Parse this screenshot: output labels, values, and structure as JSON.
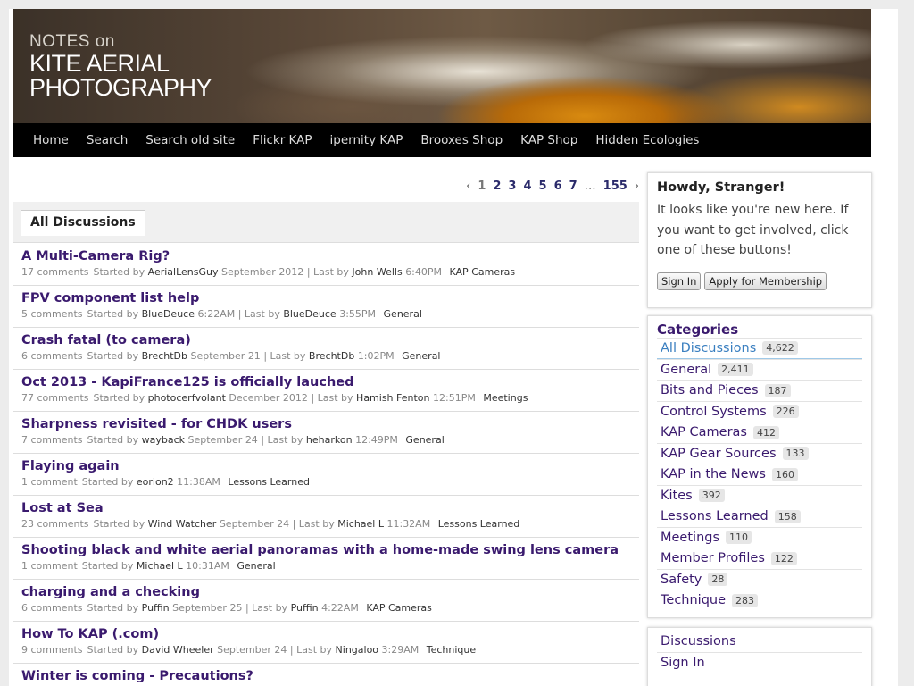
{
  "site": {
    "notes": "NOTES on",
    "title_line1": "KITE AERIAL",
    "title_line2": "PHOTOGRAPHY"
  },
  "nav": [
    "Home",
    "Search",
    "Search old site",
    "Flickr KAP",
    "ipernity KAP",
    "Brooxes Shop",
    "KAP Shop",
    "Hidden Ecologies"
  ],
  "pager": {
    "prev": "‹",
    "pages": [
      "1",
      "2",
      "3",
      "4",
      "5",
      "6",
      "7"
    ],
    "ellipsis": "…",
    "last": "155",
    "next": "›"
  },
  "tab": "All Discussions",
  "discussions": [
    {
      "title": "A Multi-Camera Rig?",
      "comments": "17 comments",
      "started_by": "AerialLensGuy",
      "started": "September 2012",
      "last_by": "John Wells",
      "last": "6:40PM",
      "category": "KAP Cameras"
    },
    {
      "title": "FPV component list help",
      "comments": "5 comments",
      "started_by": "BlueDeuce",
      "started": "6:22AM",
      "last_by": "BlueDeuce",
      "last": "3:55PM",
      "category": "General"
    },
    {
      "title": "Crash fatal (to camera)",
      "comments": "6 comments",
      "started_by": "BrechtDb",
      "started": "September 21",
      "last_by": "BrechtDb",
      "last": "1:02PM",
      "category": "General"
    },
    {
      "title": "Oct 2013 - KapiFrance125 is officially lauched",
      "comments": "77 comments",
      "started_by": "photocerfvolant",
      "started": "December 2012",
      "last_by": "Hamish Fenton",
      "last": "12:51PM",
      "category": "Meetings"
    },
    {
      "title": "Sharpness revisited - for CHDK users",
      "comments": "7 comments",
      "started_by": "wayback",
      "started": "September 24",
      "last_by": "heharkon",
      "last": "12:49PM",
      "category": "General"
    },
    {
      "title": "Flaying again",
      "comments": "1 comment",
      "started_by": "eorion2",
      "started": "11:38AM",
      "last_by": "",
      "last": "",
      "category": "Lessons Learned"
    },
    {
      "title": "Lost at Sea",
      "comments": "23 comments",
      "started_by": "Wind Watcher",
      "started": "September 24",
      "last_by": "Michael L",
      "last": "11:32AM",
      "category": "Lessons Learned"
    },
    {
      "title": "Shooting black and white aerial panoramas with a home-made swing lens camera",
      "comments": "1 comment",
      "started_by": "Michael L",
      "started": "10:31AM",
      "last_by": "",
      "last": "",
      "category": "General"
    },
    {
      "title": "charging and a checking",
      "comments": "6 comments",
      "started_by": "Puffin",
      "started": "September 25",
      "last_by": "Puffin",
      "last": "4:22AM",
      "category": "KAP Cameras"
    },
    {
      "title": "How To KAP (.com)",
      "comments": "9 comments",
      "started_by": "David Wheeler",
      "started": "September 24",
      "last_by": "Ningaloo",
      "last": "3:29AM",
      "category": "Technique"
    },
    {
      "title": "Winter is coming - Precautions?",
      "comments": "",
      "started_by": "",
      "started": "",
      "last_by": "",
      "last": "",
      "category": ""
    }
  ],
  "labels": {
    "started_by": "Started by",
    "last_by": "| Last by"
  },
  "howdy": {
    "title": "Howdy, Stranger!",
    "text": "It looks like you're new here. If you want to get involved, click one of these buttons!",
    "signin": "Sign In",
    "apply": "Apply for Membership"
  },
  "categories": {
    "title": "Categories",
    "items": [
      {
        "name": "All Discussions",
        "count": "4,622"
      },
      {
        "name": "General",
        "count": "2,411"
      },
      {
        "name": "Bits and Pieces",
        "count": "187"
      },
      {
        "name": "Control Systems",
        "count": "226"
      },
      {
        "name": "KAP Cameras",
        "count": "412"
      },
      {
        "name": "KAP Gear Sources",
        "count": "133"
      },
      {
        "name": "KAP in the News",
        "count": "160"
      },
      {
        "name": "Kites",
        "count": "392"
      },
      {
        "name": "Lessons Learned",
        "count": "158"
      },
      {
        "name": "Meetings",
        "count": "110"
      },
      {
        "name": "Member Profiles",
        "count": "122"
      },
      {
        "name": "Safety",
        "count": "28"
      },
      {
        "name": "Technique",
        "count": "283"
      }
    ]
  },
  "bottom_links": [
    "Discussions",
    "Sign In"
  ]
}
